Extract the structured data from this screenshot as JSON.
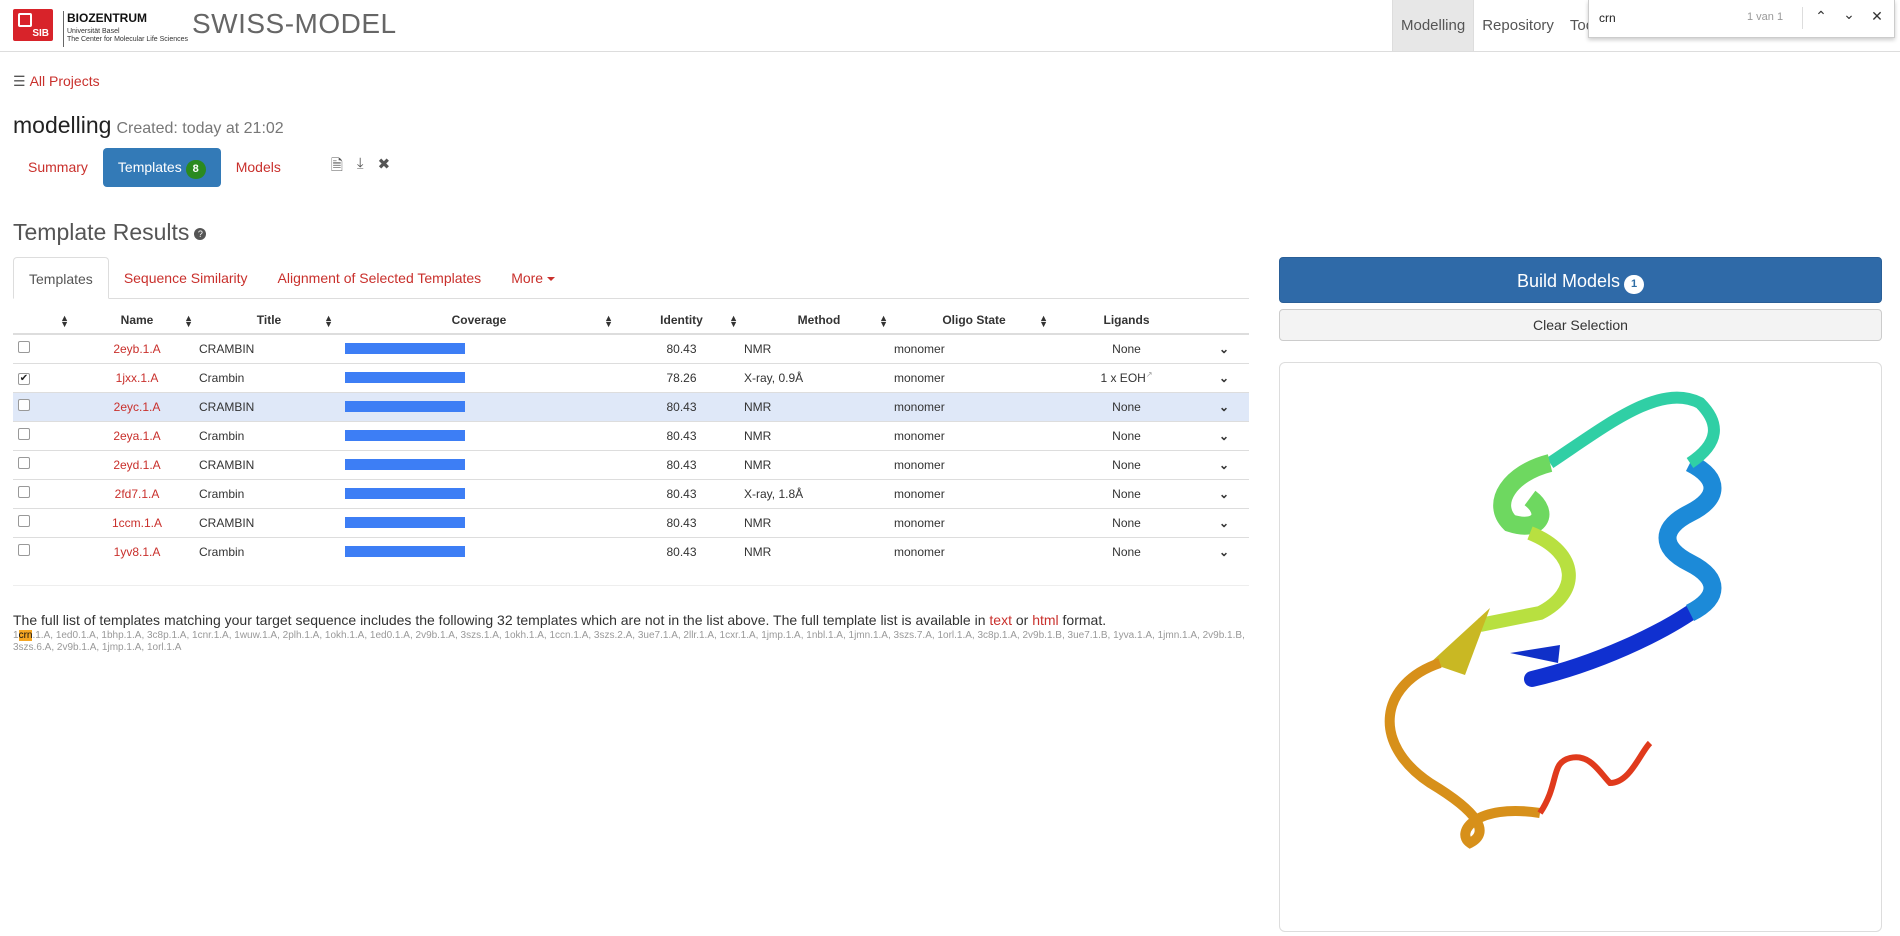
{
  "header": {
    "sib_label": "SIB",
    "biozentrum": "BIOZENTRUM",
    "biozentrum_sub1": "Universität Basel",
    "biozentrum_sub2": "The Center for Molecular Life Sciences",
    "brand": "SWISS-MODEL",
    "nav": [
      "Modelling",
      "Repository",
      "Tool"
    ]
  },
  "findbar": {
    "query": "crn",
    "count": "1 van 1"
  },
  "breadcrumb": {
    "all_projects": "All Projects"
  },
  "project": {
    "title": "modelling",
    "created": "Created: today at 21:02"
  },
  "project_tabs": {
    "summary": "Summary",
    "templates": "Templates",
    "templates_count": "8",
    "models": "Models"
  },
  "results": {
    "title": "Template Results",
    "tabs": [
      "Templates",
      "Sequence Similarity",
      "Alignment of Selected Templates",
      "More"
    ],
    "columns": [
      "Name",
      "Title",
      "Coverage",
      "Identity",
      "Method",
      "Oligo State",
      "Ligands"
    ],
    "rows": [
      {
        "checked": false,
        "name": "2eyb.1.A",
        "title": "CRAMBIN",
        "coverage": 1.0,
        "identity": "80.43",
        "method": "NMR",
        "oligo": "monomer",
        "ligands": "None",
        "highlight": false
      },
      {
        "checked": true,
        "name": "1jxx.1.A",
        "title": "Crambin",
        "coverage": 1.0,
        "identity": "78.26",
        "method": "X-ray, 0.9Å",
        "oligo": "monomer",
        "ligands": "1 x EOH",
        "highlight": false
      },
      {
        "checked": false,
        "name": "2eyc.1.A",
        "title": "CRAMBIN",
        "coverage": 1.0,
        "identity": "80.43",
        "method": "NMR",
        "oligo": "monomer",
        "ligands": "None",
        "highlight": true
      },
      {
        "checked": false,
        "name": "2eya.1.A",
        "title": "Crambin",
        "coverage": 1.0,
        "identity": "80.43",
        "method": "NMR",
        "oligo": "monomer",
        "ligands": "None",
        "highlight": false
      },
      {
        "checked": false,
        "name": "2eyd.1.A",
        "title": "CRAMBIN",
        "coverage": 1.0,
        "identity": "80.43",
        "method": "NMR",
        "oligo": "monomer",
        "ligands": "None",
        "highlight": false
      },
      {
        "checked": false,
        "name": "2fd7.1.A",
        "title": "Crambin",
        "coverage": 1.0,
        "identity": "80.43",
        "method": "X-ray, 1.8Å",
        "oligo": "monomer",
        "ligands": "None",
        "highlight": false
      },
      {
        "checked": false,
        "name": "1ccm.1.A",
        "title": "CRAMBIN",
        "coverage": 1.0,
        "identity": "80.43",
        "method": "NMR",
        "oligo": "monomer",
        "ligands": "None",
        "highlight": false
      },
      {
        "checked": false,
        "name": "1yv8.1.A",
        "title": "Crambin",
        "coverage": 1.0,
        "identity": "80.43",
        "method": "NMR",
        "oligo": "monomer",
        "ligands": "None",
        "highlight": false
      }
    ],
    "footnote_pre": "The full list of templates matching your target sequence includes the following 32 templates which are not in the list above. The full template list is available in ",
    "footnote_text_link": "text",
    "footnote_or": " or ",
    "footnote_html_link": "html",
    "footnote_post": " format.",
    "other_prefix": "1",
    "other_match": "crn",
    "other_rest": ".1.A, 1ed0.1.A, 1bhp.1.A, 3c8p.1.A, 1cnr.1.A, 1wuw.1.A, 2plh.1.A, 1okh.1.A, 1ed0.1.A, 2v9b.1.A, 3szs.1.A, 1okh.1.A, 1ccn.1.A, 3szs.2.A, 3ue7.1.A, 2llr.1.A, 1cxr.1.A, 1jmp.1.A, 1nbl.1.A, 1jmn.1.A, 3szs.7.A, 1orl.1.A, 3c8p.1.A, 2v9b.1.B, 3ue7.1.B, 1yva.1.A, 1jmn.1.A, 2v9b.1.B, 3szs.6.A, 2v9b.1.A, 1jmp.1.A, 1orl.1.A"
  },
  "sidebar": {
    "build_models": "Build Models",
    "build_count": "1",
    "clear_selection": "Clear Selection"
  },
  "colors": {
    "accent_link": "#c9302c",
    "primary": "#337ab7",
    "coverage_bar": "#3d7ef5",
    "badge_green": "#2b8a1f"
  }
}
